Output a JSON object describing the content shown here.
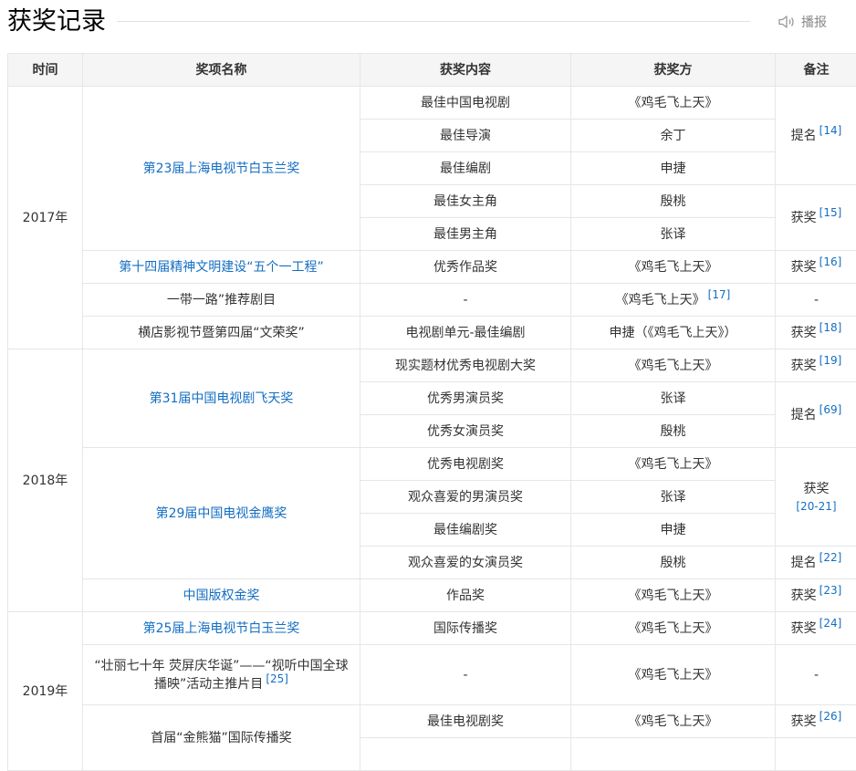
{
  "section": {
    "title": "获奖记录",
    "listen_label": "播报"
  },
  "table": {
    "headers": [
      "时间",
      "奖项名称",
      "获奖内容",
      "获奖方",
      "备注"
    ],
    "years": [
      "2017年",
      "2018年",
      "2019年"
    ],
    "awards": [
      "第23届上海电视节白玉兰奖",
      "第十四届精神文明建设“五个一工程”",
      "一带一路”推荐剧目",
      "横店影视节暨第四届“文荣奖”",
      "第31届中国电视剧飞天奖",
      "第29届中国电视金鹰奖",
      "中国版权金奖",
      "第25届上海电视节白玉兰奖",
      "“壮丽七十年 荧屏庆华诞”——“视听中国全球播映”活动主推片目",
      "首届“金熊猫”国际传播奖"
    ],
    "award_refs": {
      "a8": "[25]"
    },
    "contents": [
      "最佳中国电视剧",
      "最佳导演",
      "最佳编剧",
      "最佳女主角",
      "最佳男主角",
      "优秀作品奖",
      "-",
      "电视剧单元-最佳编剧",
      "现实题材优秀电视剧大奖",
      "优秀男演员奖",
      "优秀女演员奖",
      "优秀电视剧奖",
      "观众喜爱的男演员奖",
      "最佳编剧奖",
      "观众喜爱的女演员奖",
      "作品奖",
      "国际传播奖",
      "-",
      "最佳电视剧奖"
    ],
    "winners": [
      "《鸡毛飞上天》",
      "余丁",
      "申捷",
      "殷桃",
      "张译",
      "《鸡毛飞上天》",
      "《鸡毛飞上天》",
      "申捷（《鸡毛飞上天》）",
      "《鸡毛飞上天》",
      "张译",
      "殷桃",
      "《鸡毛飞上天》",
      "张译",
      "申捷",
      "殷桃",
      "《鸡毛飞上天》",
      "《鸡毛飞上天》",
      "《鸡毛飞上天》",
      "《鸡毛飞上天》"
    ],
    "winner_refs": {
      "w6": "[17]"
    },
    "notes": [
      {
        "text": "提名",
        "ref": "[14]"
      },
      {
        "text": "获奖",
        "ref": "[15]"
      },
      {
        "text": "获奖",
        "ref": "[16]"
      },
      {
        "text": "-",
        "ref": ""
      },
      {
        "text": "获奖",
        "ref": "[18]"
      },
      {
        "text": "获奖",
        "ref": "[19]"
      },
      {
        "text": "提名",
        "ref": "[69]"
      },
      {
        "text": "获奖",
        "ref": "[20-21]"
      },
      {
        "text": "提名",
        "ref": "[22]"
      },
      {
        "text": "获奖",
        "ref": "[23]"
      },
      {
        "text": "获奖",
        "ref": "[24]"
      },
      {
        "text": "-",
        "ref": ""
      },
      {
        "text": "获奖",
        "ref": "[26]"
      }
    ]
  }
}
